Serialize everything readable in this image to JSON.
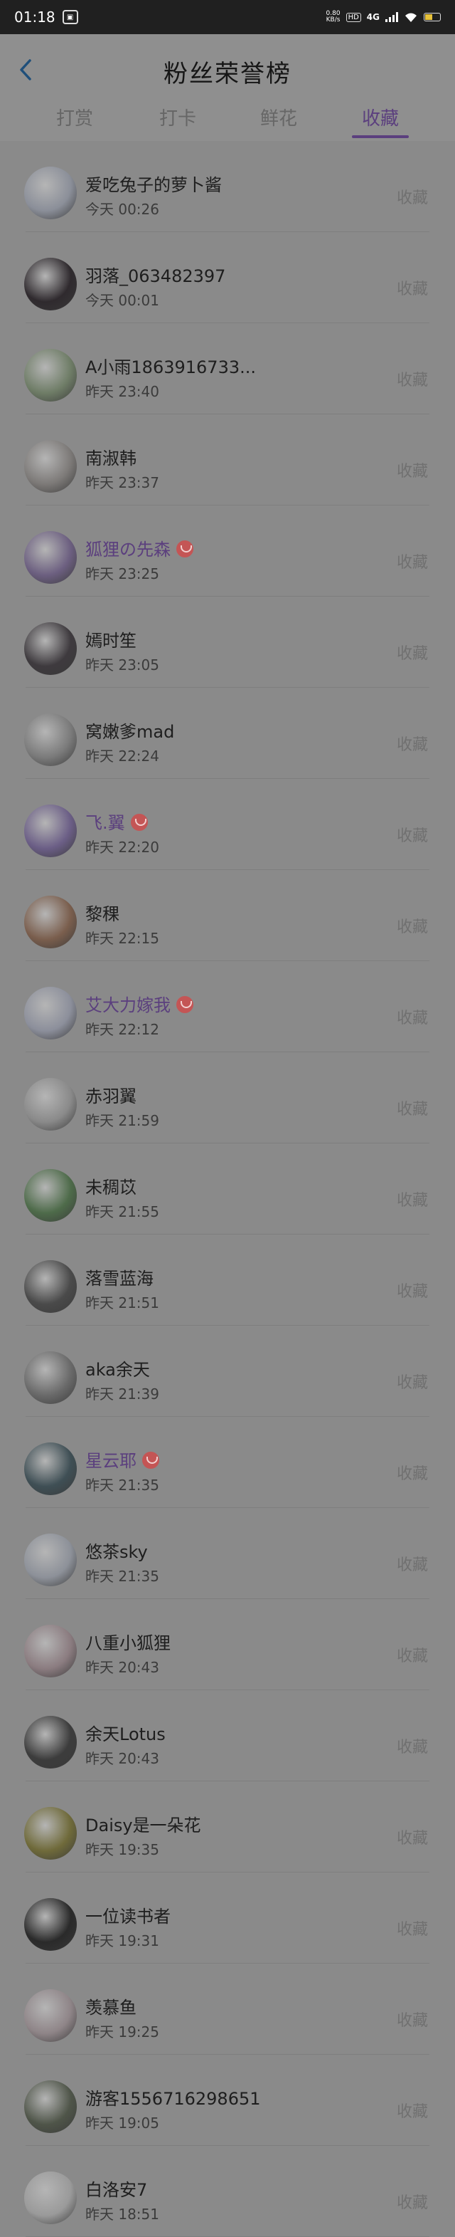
{
  "status_bar": {
    "time": "01:18",
    "net_speed_value": "0.80",
    "net_speed_unit": "KB/s",
    "hd": "HD",
    "network": "4G"
  },
  "header": {
    "title": "粉丝荣誉榜",
    "tabs": [
      {
        "label": "打赏"
      },
      {
        "label": "打卡"
      },
      {
        "label": "鲜花"
      },
      {
        "label": "收藏"
      }
    ],
    "active_tab": "收藏",
    "accent_color": "#5b3f7e"
  },
  "action_label": "收藏",
  "fans": [
    {
      "name": "爱吃兔子的萝卜酱",
      "time": "今天  00:26",
      "vip": false,
      "avatar_color": "#8b8f99"
    },
    {
      "name": "羽落_063482397",
      "time": "今天  00:01",
      "vip": false,
      "avatar_color": "#2f2a2e"
    },
    {
      "name": "A小雨1863916733...",
      "time": "昨天  23:40",
      "vip": false,
      "avatar_color": "#6f7d67"
    },
    {
      "name": "南淑韩",
      "time": "昨天  23:37",
      "vip": false,
      "avatar_color": "#7d7a78"
    },
    {
      "name": "狐狸の先森",
      "time": "昨天  23:25",
      "vip": true,
      "avatar_color": "#6c5f80"
    },
    {
      "name": "嫣时笙",
      "time": "昨天  23:05",
      "vip": false,
      "avatar_color": "#3e3a3e"
    },
    {
      "name": "窝嫩爹mad",
      "time": "昨天  22:24",
      "vip": false,
      "avatar_color": "#7b7b7b"
    },
    {
      "name": "飞.翼",
      "time": "昨天  22:20",
      "vip": true,
      "avatar_color": "#6b5e86"
    },
    {
      "name": "黎稞",
      "time": "昨天  22:15",
      "vip": false,
      "avatar_color": "#7a5e4d"
    },
    {
      "name": "艾大力嫁我",
      "time": "昨天  22:12",
      "vip": true,
      "avatar_color": "#8c8f9b"
    },
    {
      "name": "赤羽翼",
      "time": "昨天  21:59",
      "vip": false,
      "avatar_color": "#8a8a8a"
    },
    {
      "name": "未稠苡",
      "time": "昨天  21:55",
      "vip": false,
      "avatar_color": "#4e6b4a"
    },
    {
      "name": "落雪蓝海",
      "time": "昨天  21:51",
      "vip": false,
      "avatar_color": "#4a4a4a"
    },
    {
      "name": "aka余天",
      "time": "昨天  21:39",
      "vip": false,
      "avatar_color": "#6a6a6a"
    },
    {
      "name": "星云耶",
      "time": "昨天  21:35",
      "vip": true,
      "avatar_color": "#3f4f55"
    },
    {
      "name": "悠茶sky",
      "time": "昨天  21:35",
      "vip": false,
      "avatar_color": "#8d9199"
    },
    {
      "name": "八重小狐狸",
      "time": "昨天  20:43",
      "vip": false,
      "avatar_color": "#8b7c80"
    },
    {
      "name": "余天Lotus",
      "time": "昨天  20:43",
      "vip": false,
      "avatar_color": "#3c3c3c"
    },
    {
      "name": "Daisy是一朵花",
      "time": "昨天  19:35",
      "vip": false,
      "avatar_color": "#6f6a3a"
    },
    {
      "name": "一位读书者",
      "time": "昨天  19:31",
      "vip": false,
      "avatar_color": "#2a2a2a"
    },
    {
      "name": "羡慕鱼",
      "time": "昨天  19:25",
      "vip": false,
      "avatar_color": "#8f8588"
    },
    {
      "name": "游客1556716298651",
      "time": "昨天  19:05",
      "vip": false,
      "avatar_color": "#4f5549"
    },
    {
      "name": "白洛安7",
      "time": "昨天  18:51",
      "vip": false,
      "avatar_color": "#9a9a9a"
    }
  ]
}
